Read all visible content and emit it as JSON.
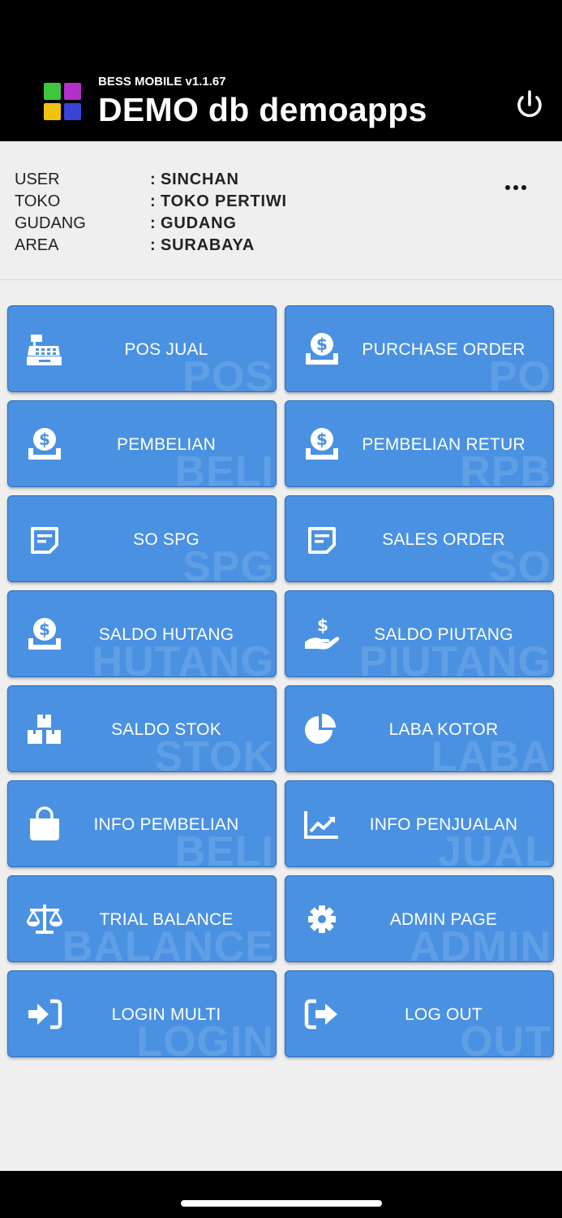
{
  "header": {
    "app_version": "BESS MOBILE v1.1.67",
    "title": "DEMO db demoapps",
    "logo_colors": [
      "#3ec63e",
      "#b32fc9",
      "#f2c211",
      "#3a43d8"
    ]
  },
  "info": {
    "rows": [
      {
        "label": "USER",
        "value": "SINCHAN"
      },
      {
        "label": "TOKO",
        "value": "TOKO PERTIWI"
      },
      {
        "label": "GUDANG",
        "value": "GUDANG"
      },
      {
        "label": "AREA",
        "value": "SURABAYA"
      }
    ]
  },
  "menu": {
    "tiles": [
      {
        "label": "POS JUAL",
        "watermark": "POS",
        "icon": "cash-register-icon"
      },
      {
        "label": "PURCHASE ORDER",
        "watermark": "PO",
        "icon": "money-tray-icon"
      },
      {
        "label": "PEMBELIAN",
        "watermark": "BELI",
        "icon": "money-tray-icon"
      },
      {
        "label": "PEMBELIAN RETUR",
        "watermark": "RPB",
        "icon": "money-tray-icon"
      },
      {
        "label": "SO SPG",
        "watermark": "SPG",
        "icon": "note-icon"
      },
      {
        "label": "SALES ORDER",
        "watermark": "SO",
        "icon": "note-icon"
      },
      {
        "label": "SALDO HUTANG",
        "watermark": "HUTANG",
        "icon": "money-tray-icon"
      },
      {
        "label": "SALDO PIUTANG",
        "watermark": "PIUTANG",
        "icon": "hand-dollar-icon"
      },
      {
        "label": "SALDO STOK",
        "watermark": "STOK",
        "icon": "boxes-icon"
      },
      {
        "label": "LABA KOTOR",
        "watermark": "LABA",
        "icon": "pie-chart-icon"
      },
      {
        "label": "INFO PEMBELIAN",
        "watermark": "BELI",
        "icon": "shopping-bag-icon"
      },
      {
        "label": "INFO PENJUALAN",
        "watermark": "JUAL",
        "icon": "trend-chart-icon"
      },
      {
        "label": "TRIAL BALANCE",
        "watermark": "BALANCE",
        "icon": "scale-icon"
      },
      {
        "label": "ADMIN PAGE",
        "watermark": "ADMIN",
        "icon": "gear-icon"
      },
      {
        "label": "LOGIN MULTI",
        "watermark": "LOGIN",
        "icon": "sign-in-icon"
      },
      {
        "label": "LOG OUT",
        "watermark": "OUT",
        "icon": "sign-out-icon"
      }
    ],
    "tile_color": "#4a91e2"
  }
}
